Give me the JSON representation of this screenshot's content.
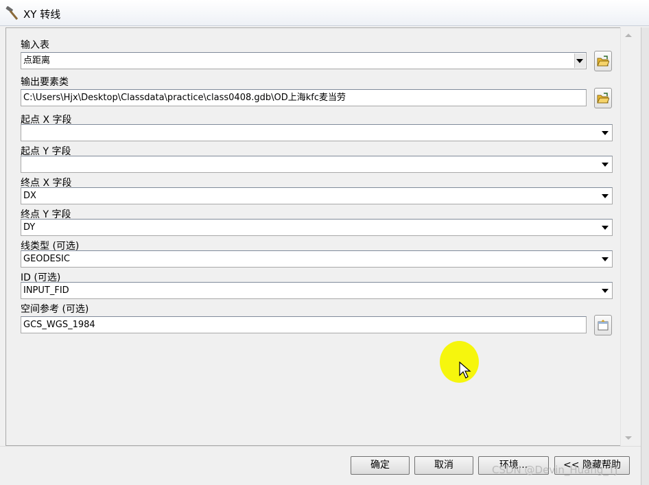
{
  "window": {
    "title": "XY 转线"
  },
  "form": {
    "input_table": {
      "label": "输入表",
      "value": "点距离"
    },
    "output_feature_class": {
      "label": "输出要素类",
      "value": "C:\\Users\\Hjx\\Desktop\\Classdata\\practice\\class0408.gdb\\OD上海kfc麦当劳"
    },
    "start_x_field": {
      "label": "起点 X 字段",
      "value": ""
    },
    "start_y_field": {
      "label": "起点 Y 字段",
      "value": ""
    },
    "end_x_field": {
      "label": "终点 X 字段",
      "value": "DX"
    },
    "end_y_field": {
      "label": "终点 Y 字段",
      "value": "DY"
    },
    "line_type": {
      "label": "线类型 (可选)",
      "value": "GEODESIC"
    },
    "id_field": {
      "label": "ID (可选)",
      "value": "INPUT_FID"
    },
    "spatial_reference": {
      "label": "空间参考 (可选)",
      "value": "GCS_WGS_1984"
    }
  },
  "buttons": {
    "ok": "确定",
    "cancel": "取消",
    "environments": "环境...",
    "hide_help": "<< 隐藏帮助"
  },
  "watermark": "CSDN @Devin_Huang_TJ",
  "colors": {
    "cursor_highlight": "#f5f500",
    "folder_icon": "#e8b832"
  }
}
